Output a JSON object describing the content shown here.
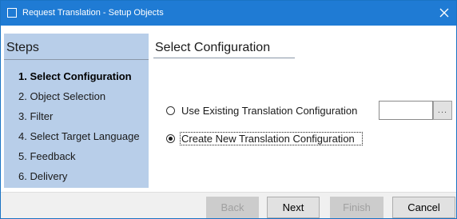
{
  "window": {
    "title": "Request Translation - Setup Objects"
  },
  "steps": {
    "title": "Steps",
    "items": [
      {
        "label": "1. Select Configuration",
        "active": true
      },
      {
        "label": "2. Object Selection",
        "active": false
      },
      {
        "label": "3. Filter",
        "active": false
      },
      {
        "label": "4. Select Target Language",
        "active": false
      },
      {
        "label": "5. Feedback",
        "active": false
      },
      {
        "label": "6. Delivery",
        "active": false
      }
    ]
  },
  "main": {
    "title": "Select Configuration",
    "options": [
      {
        "label": "Use Existing Translation Configuration",
        "selected": false
      },
      {
        "label": "Create New Translation Configuration",
        "selected": true
      }
    ],
    "config_input": {
      "value": "",
      "placeholder": ""
    },
    "browse_label": "..."
  },
  "footer": {
    "back_label": "Back",
    "next_label": "Next",
    "finish_label": "Finish",
    "cancel_label": "Cancel"
  },
  "colors": {
    "title_bar": "#1f7bd4",
    "steps_panel": "#b8cee9",
    "dialog_background": "#f0f0f0"
  },
  "icons": {
    "window": "app-window-icon",
    "close": "close-icon"
  }
}
